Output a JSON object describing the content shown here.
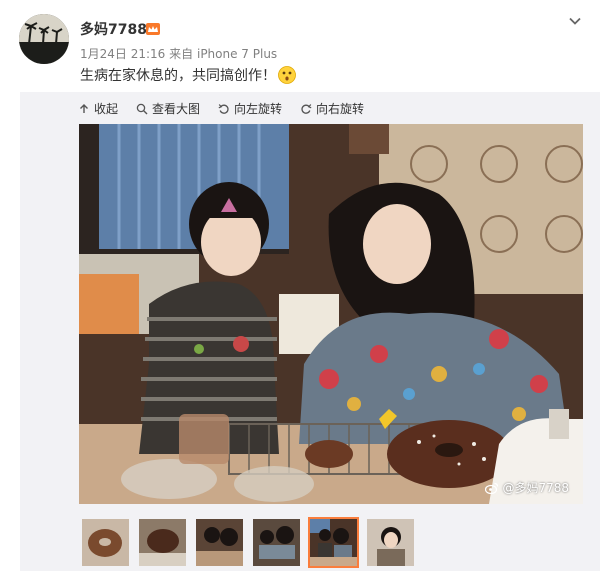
{
  "post": {
    "username": "多妈7788",
    "time": "1月24日 21:16",
    "source_prefix": "来自",
    "device": "iPhone 7 Plus",
    "text": "生病在家休息的，共同搞创作！"
  },
  "toolbar": {
    "collapse_label": "收起",
    "view_large_label": "查看大图",
    "rotate_left_label": "向左旋转",
    "rotate_right_label": "向右旋转"
  },
  "photo": {
    "watermark": "@多妈7788"
  },
  "thumbnails": {
    "count": 6,
    "active_index": 4
  },
  "colors": {
    "accent_orange": "#fa7d3c",
    "meta_gray": "#808080",
    "panel_bg": "#f2f2f5"
  }
}
